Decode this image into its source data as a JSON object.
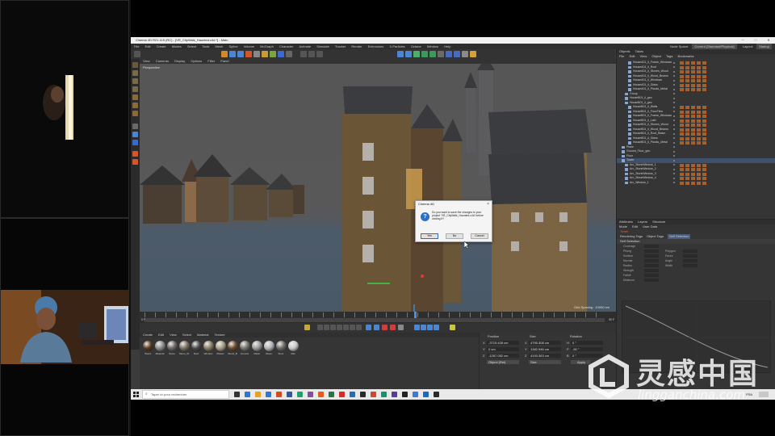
{
  "app": {
    "title": "Cinema 4D R21.115 (RC) - [VR_CityWalk_Haunted.c4d *] - Main",
    "menu": [
      "File",
      "Edit",
      "Create",
      "Modes",
      "Select",
      "Tools",
      "Mesh",
      "Spline",
      "Volume",
      "MoGraph",
      "Character",
      "Animate",
      "Simulate",
      "Tracker",
      "Render",
      "Extensions",
      "X-Particles",
      "Octane",
      "Window",
      "Help"
    ],
    "node_space_label": "Node Space:",
    "node_space_value": "Current (Standard/Physical)",
    "layout_label": "Layout:",
    "layout_value": "Startup"
  },
  "viewport": {
    "menu": [
      "View",
      "Cameras",
      "Display",
      "Options",
      "Filter",
      "Panel"
    ],
    "label": "Perspective",
    "grid_info": "Grid Spacing : 10000 cm"
  },
  "timeline": {
    "start": "0 F",
    "end": "90 F",
    "frame_labels": [
      "0",
      "5",
      "10",
      "15",
      "20",
      "25",
      "30",
      "35",
      "40",
      "45",
      "50",
      "55",
      "60",
      "65",
      "70",
      "75",
      "80",
      "85",
      "90"
    ]
  },
  "dialog": {
    "title": "Cinema 4D",
    "close": "×",
    "message": "Do you want to save the changes to your project 'VR_CityWalk_Haunted.c4d' before closing it?",
    "buttons": [
      "Yes",
      "No",
      "Cancel"
    ]
  },
  "material_manager": {
    "menu": [
      "Create",
      "Edit",
      "View",
      "Select",
      "Material",
      "Texture"
    ],
    "materials": [
      {
        "name": "Wood",
        "color": "#5a3a22"
      },
      {
        "name": "Material",
        "color": "#8a8a88"
      },
      {
        "name": "Stone",
        "color": "#6a6660"
      },
      {
        "name": "Stone_W",
        "color": "#7a6f62"
      },
      {
        "name": "Roof",
        "color": "#4a4a4e"
      },
      {
        "name": "Window",
        "color": "#8a7c64"
      },
      {
        "name": "Plaster",
        "color": "#a89c86"
      },
      {
        "name": "Wood_B",
        "color": "#6a4a2a"
      },
      {
        "name": "Ground",
        "color": "#77736c"
      },
      {
        "name": "Metal",
        "color": "#9a9a9a"
      },
      {
        "name": "Glass",
        "color": "#b0b4b8"
      },
      {
        "name": "Floor",
        "color": "#6e6a66"
      },
      {
        "name": "Mat",
        "color": "#c8c8c8"
      }
    ]
  },
  "coordinates": {
    "headers": [
      "Position",
      "Size",
      "Rotation"
    ],
    "rows": [
      {
        "axis": "X",
        "pos": "-3715.428 cm",
        "size_axis": "X",
        "size": "4795.308 cm",
        "rot_axis": "H",
        "rot": "0 °"
      },
      {
        "axis": "Y",
        "pos": "0 cm",
        "size_axis": "Y",
        "size": "1382.946 cm",
        "rot_axis": "P",
        "rot": "-90 °"
      },
      {
        "axis": "Z",
        "pos": "-1267.052 cm",
        "size_axis": "Z",
        "size": "4193.363 cm",
        "rot_axis": "B",
        "rot": "0 °"
      }
    ],
    "mode_select": "Object (Rel)",
    "size_select": "Size",
    "apply": "Apply"
  },
  "object_manager": {
    "tabs": [
      "Objects",
      "Takes"
    ],
    "menu": [
      "File",
      "Edit",
      "View",
      "Object",
      "Tags",
      "Bookmarks"
    ],
    "rows": [
      {
        "name": "HouseA01_ii_Frame_Windows",
        "indent": 2,
        "tags": true
      },
      {
        "name": "HouseA01_ii_Roof",
        "indent": 2,
        "tags": true
      },
      {
        "name": "HouseA01_ii_Stones_Wood",
        "indent": 2,
        "tags": true
      },
      {
        "name": "HouseA01_ii_Wood_Beams",
        "indent": 2,
        "tags": true
      },
      {
        "name": "HouseA01_ii_Windows",
        "indent": 2,
        "tags": true
      },
      {
        "name": "HouseA01_ii_Glass",
        "indent": 2,
        "tags": true
      },
      {
        "name": "HouseA01_ii_Planks_Metal",
        "indent": 2,
        "tags": true
      },
      {
        "name": "Group",
        "indent": 1,
        "tags": false
      },
      {
        "name": "HouseB01_ii_geo",
        "indent": 1,
        "tags": false
      },
      {
        "name": "HouseB01_ii_geo",
        "indent": 1,
        "tags": false
      },
      {
        "name": "HouseB01_ii_Walls",
        "indent": 2,
        "tags": true
      },
      {
        "name": "HouseB01_ii_FloorTiles",
        "indent": 2,
        "tags": true
      },
      {
        "name": "HouseB01_ii_Frame_Windows",
        "indent": 2,
        "tags": true
      },
      {
        "name": "HouseB01_ii_Lath",
        "indent": 2,
        "tags": true
      },
      {
        "name": "HouseB01_ii_Stones_Wood",
        "indent": 2,
        "tags": true
      },
      {
        "name": "HouseB01_ii_Wood_Beams",
        "indent": 2,
        "tags": true
      },
      {
        "name": "HouseB01_ii_Roof_Beam",
        "indent": 2,
        "tags": true
      },
      {
        "name": "HouseB01_ii_Glass",
        "indent": 2,
        "tags": true
      },
      {
        "name": "HouseB01_ii_Planks_Metal",
        "indent": 2,
        "tags": true
      },
      {
        "name": "Plane",
        "indent": 0,
        "tags": false
      },
      {
        "name": "Ground_Floor_geo",
        "indent": 0,
        "tags": false
      },
      {
        "name": "Floor",
        "indent": 0,
        "tags": false
      },
      {
        "name": "Tower",
        "indent": 0,
        "tags": false,
        "selected": true
      },
      {
        "name": "Arc_StoneWindow_1",
        "indent": 1,
        "tags": true
      },
      {
        "name": "Arc_StoneWindow_2",
        "indent": 1,
        "tags": true
      },
      {
        "name": "Arc_StoneWindow_3",
        "indent": 1,
        "tags": true
      },
      {
        "name": "Arc_StoneWindow_4",
        "indent": 1,
        "tags": true
      },
      {
        "name": "Arc_Window_1",
        "indent": 1,
        "tags": true
      }
    ]
  },
  "attributes": {
    "tabs": [
      "Attributes",
      "Layers",
      "Structure"
    ],
    "menu": [
      "Mode",
      "Edit",
      "User Data"
    ],
    "title": "Tower",
    "subtabs": [
      {
        "label": "Rendering Tags",
        "on": false
      },
      {
        "label": "Object Tags",
        "on": false
      },
      {
        "label": "Self Selection",
        "on": true
      }
    ],
    "heading": "Self Selection",
    "rows": [
      {
        "label": "Coverage",
        "right": ""
      },
      {
        "label": "Phong",
        "right": "Polygon"
      },
      {
        "label": "Surface",
        "right": "Faces"
      },
      {
        "label": "Normal",
        "right": "Angle"
      },
      {
        "label": "Radius",
        "right": "Width"
      },
      {
        "label": "Strength",
        "right": ""
      },
      {
        "label": "Falloff",
        "right": ""
      },
      {
        "label": "Minimum",
        "right": ""
      }
    ]
  },
  "taskbar": {
    "search_placeholder": "Taper ici pour rechercher",
    "icons": [
      "#333333",
      "#2a78d6",
      "#e8a317",
      "#2b7ad8",
      "#d44b1e",
      "#2b58a8",
      "#20a06a",
      "#884aa8",
      "#e35a22",
      "#1e7a44",
      "#d22b2b",
      "#1d6fbf",
      "#2a2a2a",
      "#d6462c",
      "#1e8f6a",
      "#5a3a9a",
      "#222222",
      "#3a7ad8",
      "#1e6ab8",
      "#2a2a2a"
    ],
    "system_tray": "FRA"
  },
  "watermark": {
    "title": "灵感中国",
    "url": "lingganchina.com"
  }
}
